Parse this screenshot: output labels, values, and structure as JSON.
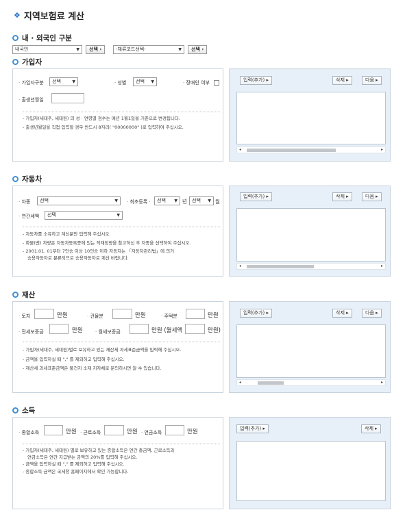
{
  "page_title": "지역보험료 계산",
  "nationality": {
    "title": "내 · 외국인 구분",
    "select1": "내국인",
    "select_button1": "선택",
    "select2": "-체류코드선택-",
    "select_button2": "선택"
  },
  "subscriber": {
    "title": "가입자",
    "type_label": "가입자구분",
    "type_value": "선택",
    "gender_label": "성별",
    "gender_value": "선택",
    "disabled_label": "장애인 여부",
    "birth_label": "출생년월일",
    "notes": [
      "가입자(세대주, 세대원) 의 성 · 연령별 점수는 매년 1월1일을 기준으로 변경됩니다.",
      "출생년월일을 직접 입력할 경우 반드시 8자리( \"00000000\" )로 입력하여 주십시오."
    ]
  },
  "car": {
    "title": "자동차",
    "kind_label": "차종",
    "kind_value": "선택",
    "reg_label": "최초등록",
    "year_value": "선택",
    "year_unit": "년",
    "month_value": "선택",
    "month_unit": "월",
    "tax_label": "연간세액",
    "tax_value": "선택",
    "notes": [
      "자동차를 소유하고 계신분만 입력해 주십시오.",
      "화물(밴) 차량은 자동차등록증에 있는 적재정량을 참고하신 후 차종을 선택하여 주십시오.",
      "2001.01. 01부터 7인승 이상 10인승 이하 자동차는 「자동차관리법」에 의거",
      "승용자동차로 분류되므로 승용자동차로 계산 바랍니다."
    ]
  },
  "property": {
    "title": "재산",
    "land_label": "토지",
    "building_label": "건물분",
    "house_label": "주택분",
    "deposit_label": "전세보증금",
    "monthly_label": "월세보증금",
    "unit": "만원",
    "rent_label": "만원 (월세액",
    "rent_unit": "만원)",
    "notes": [
      "가입자(세대주, 세대원)별로 보유하고 있는 재산세 과세표준금액을 입력해 주십시오.",
      "금액을 입력하실 때 \",\" 를 제외하고 입력해 주십시오.",
      "재산세 과세표준금액은 물건지 소재 지자체로 문의하시면 알 수 있습니다."
    ]
  },
  "income": {
    "title": "소득",
    "total_label": "종합소득",
    "earned_label": "근로소득",
    "pension_label": "연금소득",
    "unit": "만원",
    "notes": [
      "가입자(세대주, 세대원) 별로 보유하고 있는 종합소득은 연간 총금액, 근로소득과",
      "연금소득은 연간 지급받는 금액의 20%를 입력해 주십시오.",
      "금액을 입력하실 때 \",\" 를 제외하고 입력해 주십시오.",
      "종합소득 금액은 국세청 홈페이지에서 확인 가능합니다."
    ]
  },
  "panel_buttons": {
    "input_add": "입력(추가) ▸",
    "delete": "삭제 ▸",
    "next": "다음 ▸"
  }
}
